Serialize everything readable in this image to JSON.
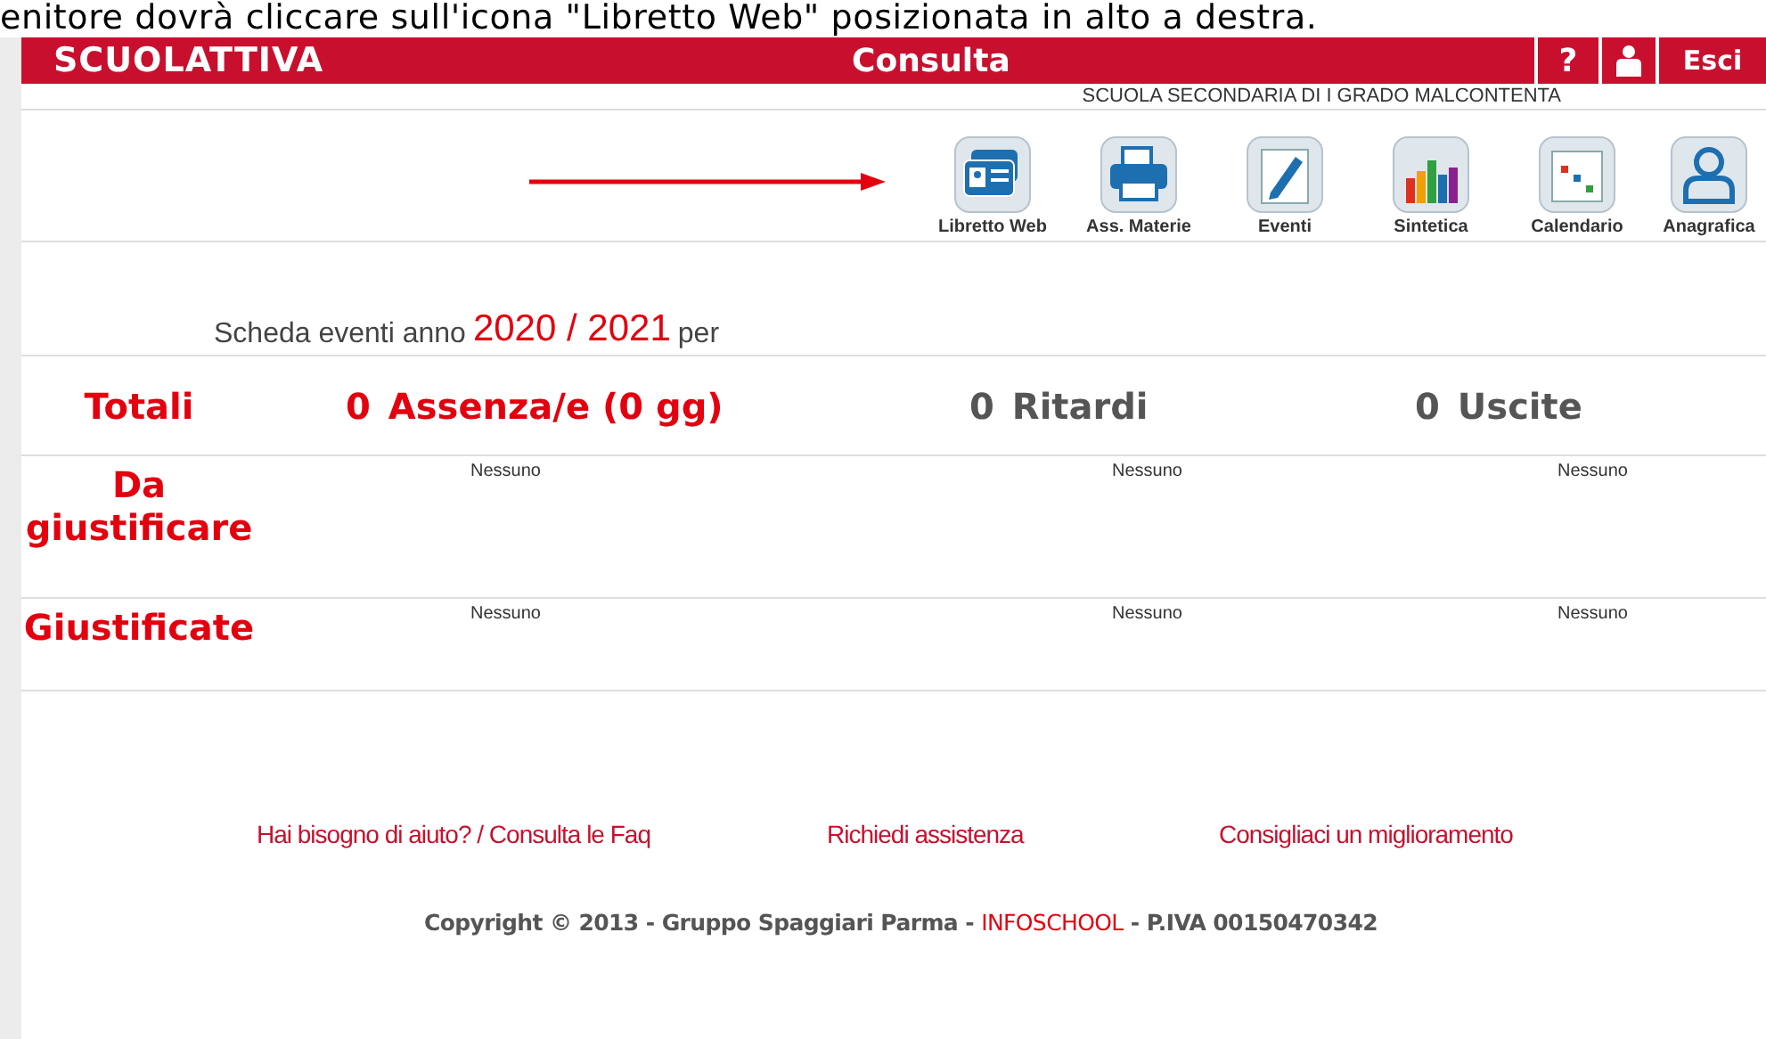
{
  "caption": "enitore dovrà cliccare sull'icona \"Libretto Web\" posizionata in alto a destra.",
  "header": {
    "logo": "SCUOLATTIVA",
    "title": "Consulta",
    "help": "?",
    "logout": "Esci"
  },
  "school": "SCUOLA SECONDARIA DI I GRADO MALCONTENTA",
  "toolbar": [
    {
      "label": "Libretto Web"
    },
    {
      "label": "Ass. Materie"
    },
    {
      "label": "Eventi"
    },
    {
      "label": "Sintetica"
    },
    {
      "label": "Calendario"
    },
    {
      "label": "Anagrafica"
    }
  ],
  "heading": {
    "prefix": "Scheda eventi anno",
    "year": "2020 / 2021",
    "suffix": "per"
  },
  "totals": {
    "label": "Totali",
    "items": [
      {
        "count": "0",
        "label": "Assenza/e (0 gg)",
        "color": "#e3000f"
      },
      {
        "count": "0",
        "label": "Ritardi",
        "color": "#555555"
      },
      {
        "count": "0",
        "label": "Uscite",
        "color": "#555555"
      }
    ]
  },
  "rows": [
    {
      "label": "Da giustificare",
      "cells": [
        "Nessuno",
        "Nessuno",
        "Nessuno"
      ]
    },
    {
      "label": "Giustificate",
      "cells": [
        "Nessuno",
        "Nessuno",
        "Nessuno"
      ]
    }
  ],
  "links": [
    "Hai bisogno di aiuto? / Consulta le Faq",
    "Richiedi assistenza",
    "Consigliaci un miglioramento"
  ],
  "copyright": {
    "before": "Copyright © 2013 - Gruppo Spaggiari Parma -",
    "brand": "INFOSCHOOL",
    "after": "- P.IVA 00150470342"
  }
}
